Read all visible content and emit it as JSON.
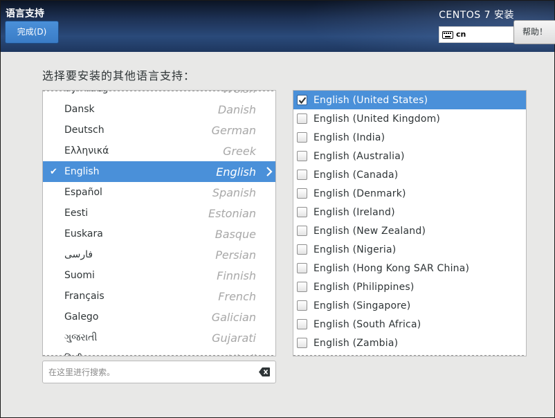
{
  "header": {
    "spoke_title": "语言支持",
    "done_label": "完成(D)",
    "product_title": "CENTOS 7 安装",
    "keyboard_layout": "cn",
    "help_label": "帮助！"
  },
  "prompt": "选择要安装的其他语言支持：",
  "languages": [
    {
      "native": "Cymraeg",
      "english": "Welsh",
      "selected": false
    },
    {
      "native": "Dansk",
      "english": "Danish",
      "selected": false
    },
    {
      "native": "Deutsch",
      "english": "German",
      "selected": false
    },
    {
      "native": "Ελληνικά",
      "english": "Greek",
      "selected": false
    },
    {
      "native": "English",
      "english": "English",
      "selected": true
    },
    {
      "native": "Español",
      "english": "Spanish",
      "selected": false
    },
    {
      "native": "Eesti",
      "english": "Estonian",
      "selected": false
    },
    {
      "native": "Euskara",
      "english": "Basque",
      "selected": false
    },
    {
      "native": "فارسی",
      "english": "Persian",
      "selected": false
    },
    {
      "native": "Suomi",
      "english": "Finnish",
      "selected": false
    },
    {
      "native": "Français",
      "english": "French",
      "selected": false
    },
    {
      "native": "Galego",
      "english": "Galician",
      "selected": false
    },
    {
      "native": "ગુજરાતી",
      "english": "Gujarati",
      "selected": false
    },
    {
      "native": "हिन्दी",
      "english": "Hindi",
      "selected": false
    }
  ],
  "search": {
    "placeholder": "在这里进行搜索。",
    "value": ""
  },
  "locales": [
    {
      "label": "English (United States)",
      "checked": true
    },
    {
      "label": "English (United Kingdom)",
      "checked": false
    },
    {
      "label": "English (India)",
      "checked": false
    },
    {
      "label": "English (Australia)",
      "checked": false
    },
    {
      "label": "English (Canada)",
      "checked": false
    },
    {
      "label": "English (Denmark)",
      "checked": false
    },
    {
      "label": "English (Ireland)",
      "checked": false
    },
    {
      "label": "English (New Zealand)",
      "checked": false
    },
    {
      "label": "English (Nigeria)",
      "checked": false
    },
    {
      "label": "English (Hong Kong SAR China)",
      "checked": false
    },
    {
      "label": "English (Philippines)",
      "checked": false
    },
    {
      "label": "English (Singapore)",
      "checked": false
    },
    {
      "label": "English (South Africa)",
      "checked": false
    },
    {
      "label": "English (Zambia)",
      "checked": false
    }
  ],
  "colors": {
    "accent": "#4a90d9",
    "header_bg": "#1d3154",
    "window_bg": "#e8e8e7"
  }
}
